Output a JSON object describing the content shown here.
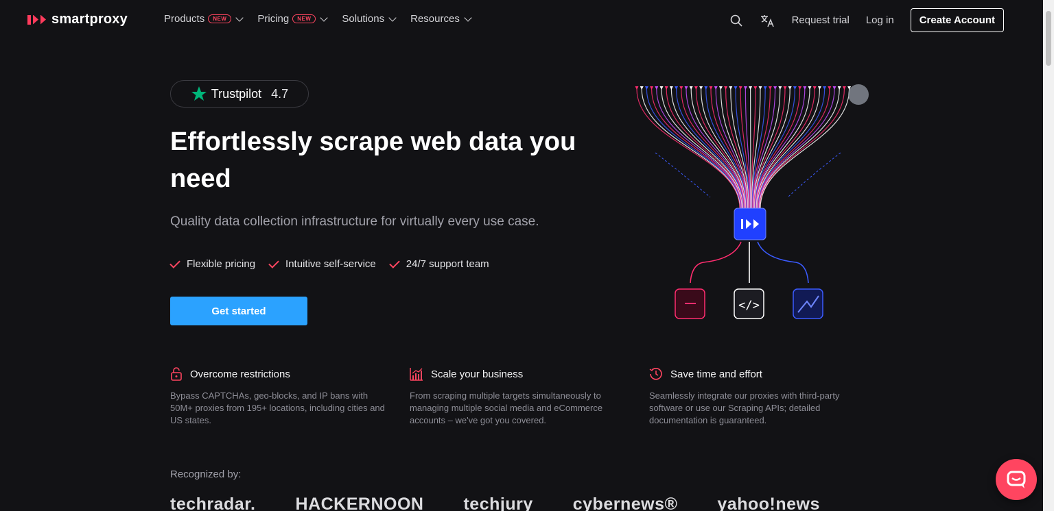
{
  "brand": {
    "name": "smartproxy",
    "accent": "#ff4560",
    "cta_color": "#2ba2ff"
  },
  "nav": {
    "items": [
      {
        "label": "Products",
        "badge": "NEW"
      },
      {
        "label": "Pricing",
        "badge": "NEW"
      },
      {
        "label": "Solutions"
      },
      {
        "label": "Resources"
      }
    ],
    "request_trial": "Request trial",
    "login": "Log in",
    "create_account": "Create Account",
    "search_icon": "search-icon",
    "translate_icon": "translate-icon"
  },
  "hero": {
    "trustpilot_label": "Trustpilot",
    "trustpilot_rating": "4.7",
    "title": "Effortlessly scrape web data you need",
    "subtitle": "Quality data collection infrastructure for virtually every use case.",
    "features": [
      "Flexible pricing",
      "Intuitive self-service",
      "24/7 support team"
    ],
    "cta": "Get started"
  },
  "benefits": [
    {
      "icon": "unlock-icon",
      "title": "Overcome restrictions",
      "text": "Bypass CAPTCHAs, geo-blocks, and IP bans with 50M+ proxies from 195+ locations, including cities and US states."
    },
    {
      "icon": "growth-chart-icon",
      "title": "Scale your business",
      "text": "From scraping multiple targets simultaneously to managing multiple social media and eCommerce accounts – we've got you covered."
    },
    {
      "icon": "clock-refresh-icon",
      "title": "Save time and effort",
      "text": "Seamlessly integrate our proxies with third-party software or use our Scraping APIs; detailed documentation is guaranteed."
    }
  ],
  "recognized": {
    "label": "Recognized by:",
    "logos": [
      "techradar.",
      "HACKERNOON",
      "techjury",
      "cybernews®",
      "yahoo!news"
    ]
  }
}
